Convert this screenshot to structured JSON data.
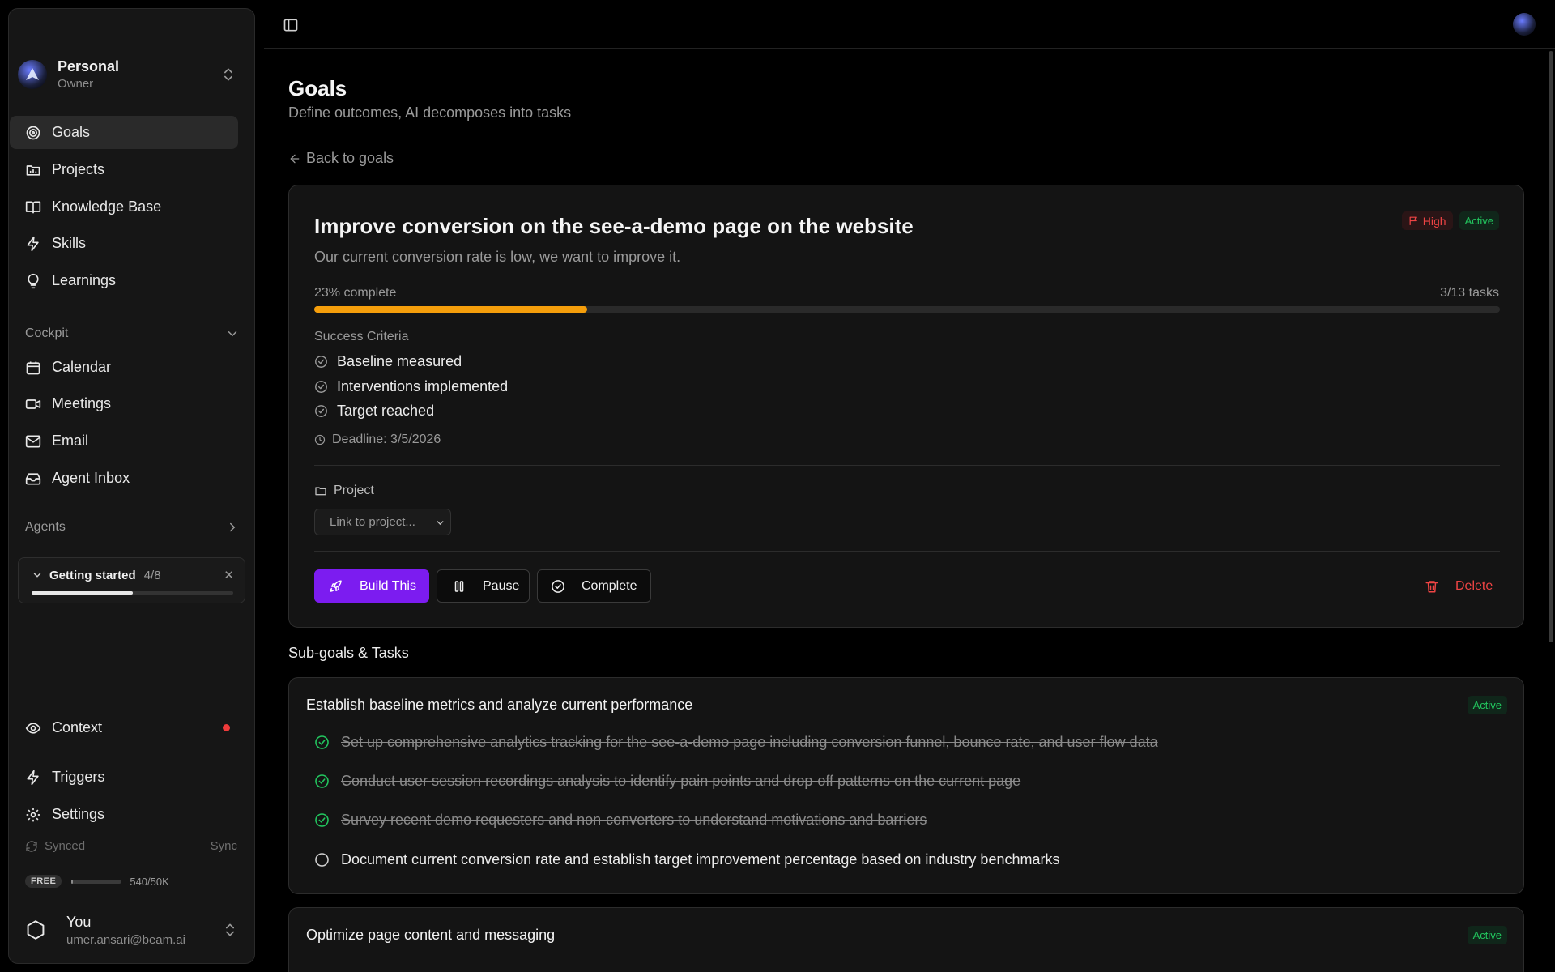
{
  "workspace": {
    "name": "Personal",
    "role": "Owner"
  },
  "nav": {
    "main": [
      {
        "label": "Goals",
        "icon": "target-icon",
        "active": true
      },
      {
        "label": "Projects",
        "icon": "projects-icon"
      },
      {
        "label": "Knowledge Base",
        "icon": "book-icon"
      },
      {
        "label": "Skills",
        "icon": "bolt-icon"
      },
      {
        "label": "Learnings",
        "icon": "lightbulb-icon"
      }
    ],
    "cockpit_label": "Cockpit",
    "cockpit": [
      {
        "label": "Calendar",
        "icon": "calendar-icon"
      },
      {
        "label": "Meetings",
        "icon": "video-icon"
      },
      {
        "label": "Email",
        "icon": "mail-icon"
      },
      {
        "label": "Agent Inbox",
        "icon": "inbox-icon"
      }
    ],
    "agents_label": "Agents",
    "bottom": [
      {
        "label": "Context",
        "icon": "eye-icon"
      },
      {
        "label": "Triggers",
        "icon": "bolt-icon"
      },
      {
        "label": "Settings",
        "icon": "gear-icon"
      }
    ]
  },
  "getting_started": {
    "label": "Getting started",
    "count": "4/8",
    "progress": 0.5
  },
  "sync": {
    "status": "Synced",
    "action": "Sync"
  },
  "plan": {
    "badge": "FREE",
    "usage": "540/50K",
    "progress": 0.0108
  },
  "user": {
    "name": "You",
    "email": "umer.ansari@beam.ai"
  },
  "page": {
    "title": "Goals",
    "subtitle": "Define outcomes, AI decomposes into tasks",
    "back_label": "Back to goals"
  },
  "goal": {
    "title": "Improve conversion on the see-a-demo page on the website",
    "description": "Our current conversion rate is low, we want to improve it.",
    "priority": "High",
    "status": "Active",
    "progress_label": "23% complete",
    "progress": 0.23,
    "tasks_label": "3/13 tasks",
    "success_criteria_label": "Success Criteria",
    "criteria": [
      "Baseline measured",
      "Interventions implemented",
      "Target reached"
    ],
    "deadline": "Deadline: 3/5/2026",
    "project_label": "Project",
    "project_placeholder": "Link to project...",
    "buttons": {
      "build": "Build This",
      "pause": "Pause",
      "complete": "Complete",
      "delete": "Delete"
    }
  },
  "subgoals_label": "Sub-goals & Tasks",
  "subgoals": [
    {
      "title": "Establish baseline metrics and analyze current performance",
      "status": "Active",
      "tasks": [
        {
          "text": "Set up comprehensive analytics tracking for the see-a-demo page including conversion funnel, bounce rate, and user flow data",
          "done": true
        },
        {
          "text": "Conduct user session recordings analysis to identify pain points and drop-off patterns on the current page",
          "done": true
        },
        {
          "text": "Survey recent demo requesters and non-converters to understand motivations and barriers",
          "done": true
        },
        {
          "text": "Document current conversion rate and establish target improvement percentage based on industry benchmarks",
          "done": false
        }
      ]
    },
    {
      "title": "Optimize page content and messaging",
      "status": "Active",
      "tasks": []
    }
  ],
  "colors": {
    "accent": "#7c1cf0",
    "progress": "#f59e0b",
    "success": "#22c55e",
    "danger": "#ef4444"
  }
}
